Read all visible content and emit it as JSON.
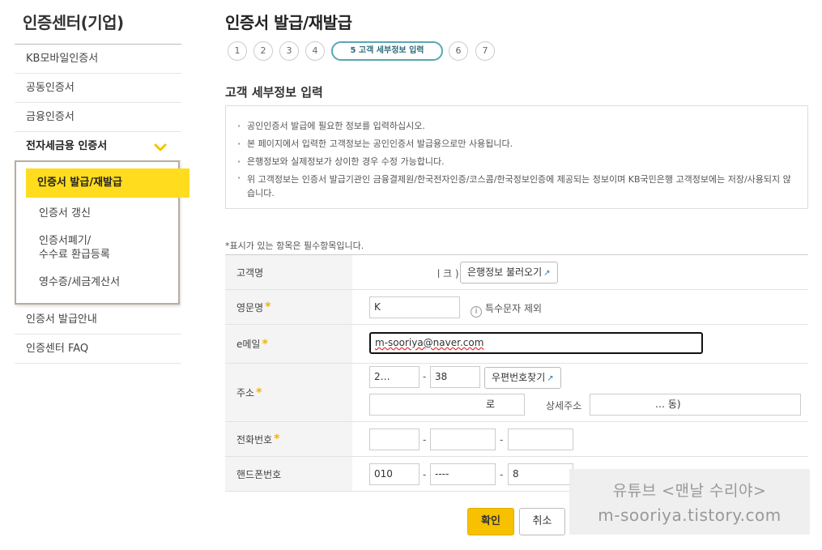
{
  "sidebar": {
    "title": "인증센터(기업)",
    "items": [
      {
        "label": "KB모바일인증서"
      },
      {
        "label": "공동인증서"
      },
      {
        "label": "금융인증서"
      },
      {
        "label": "전자세금용 인증서"
      },
      {
        "label": "인증서 발급안내"
      },
      {
        "label": "인증센터 FAQ"
      }
    ],
    "sub_items": [
      {
        "label": "인증서 발급/재발급"
      },
      {
        "label": "인증서 갱신"
      },
      {
        "label": "인증서폐기/"
      },
      {
        "label": "수수료 환급등록"
      },
      {
        "label": "영수증/세금계산서"
      }
    ],
    "chevron_icon": "chevron-down-icon"
  },
  "main": {
    "title": "인증서 발급/재발급",
    "steps": [
      "1",
      "2",
      "3",
      "4",
      "5 고객 세부정보 입력",
      "6",
      "7"
    ],
    "section_title": "고객 세부정보 입력",
    "notices": [
      "공인인증서 발급에 필요한 정보를 입력하십시오.",
      "본 페이지에서 입력한 고객정보는 공인인증서 발급용으로만 사용됩니다.",
      "은행정보와 실제정보가 상이한 경우 수정 가능합니다.",
      "위 고객정보는 인증서 발급기관인 금융결제원/한국전자인증/코스콤/한국정보인증에 제공되는 정보이며 KB국민은행 고객정보에는 저장/사용되지 않습니다."
    ],
    "required_note": "*표시가 있는 항목은 필수항목입니다."
  },
  "form": {
    "customer_name": {
      "label": "고객명",
      "value": "ㅣ크 )",
      "load_button": "은행정보 불러오기"
    },
    "english_name": {
      "label": "영문명",
      "value": "K",
      "hint": "특수문자 제외"
    },
    "email": {
      "label": "e메일",
      "value": "m-sooriya@naver.com"
    },
    "address": {
      "label": "주소",
      "zip1": "2…",
      "zip2": "38",
      "zip_button": "우편번호찾기",
      "road": "로",
      "detail_label": "상세주소",
      "detail_value": "… 동)"
    },
    "phone": {
      "label": "전화번호",
      "p1": "",
      "p2": "",
      "p3": ""
    },
    "mobile": {
      "label": "핸드폰번호",
      "p1": "010",
      "p2": "----",
      "p3": "8"
    }
  },
  "actions": {
    "confirm": "확인",
    "cancel": "취소"
  },
  "watermark": {
    "line1": "유튜브 <맨날 수리야>",
    "line2": "m-sooriya.tistory.com"
  },
  "colors": {
    "accent_yellow": "#ffdc1e",
    "confirm_yellow": "#f7c100",
    "step_teal": "#5aa6b4",
    "required_star": "#f0b400"
  }
}
